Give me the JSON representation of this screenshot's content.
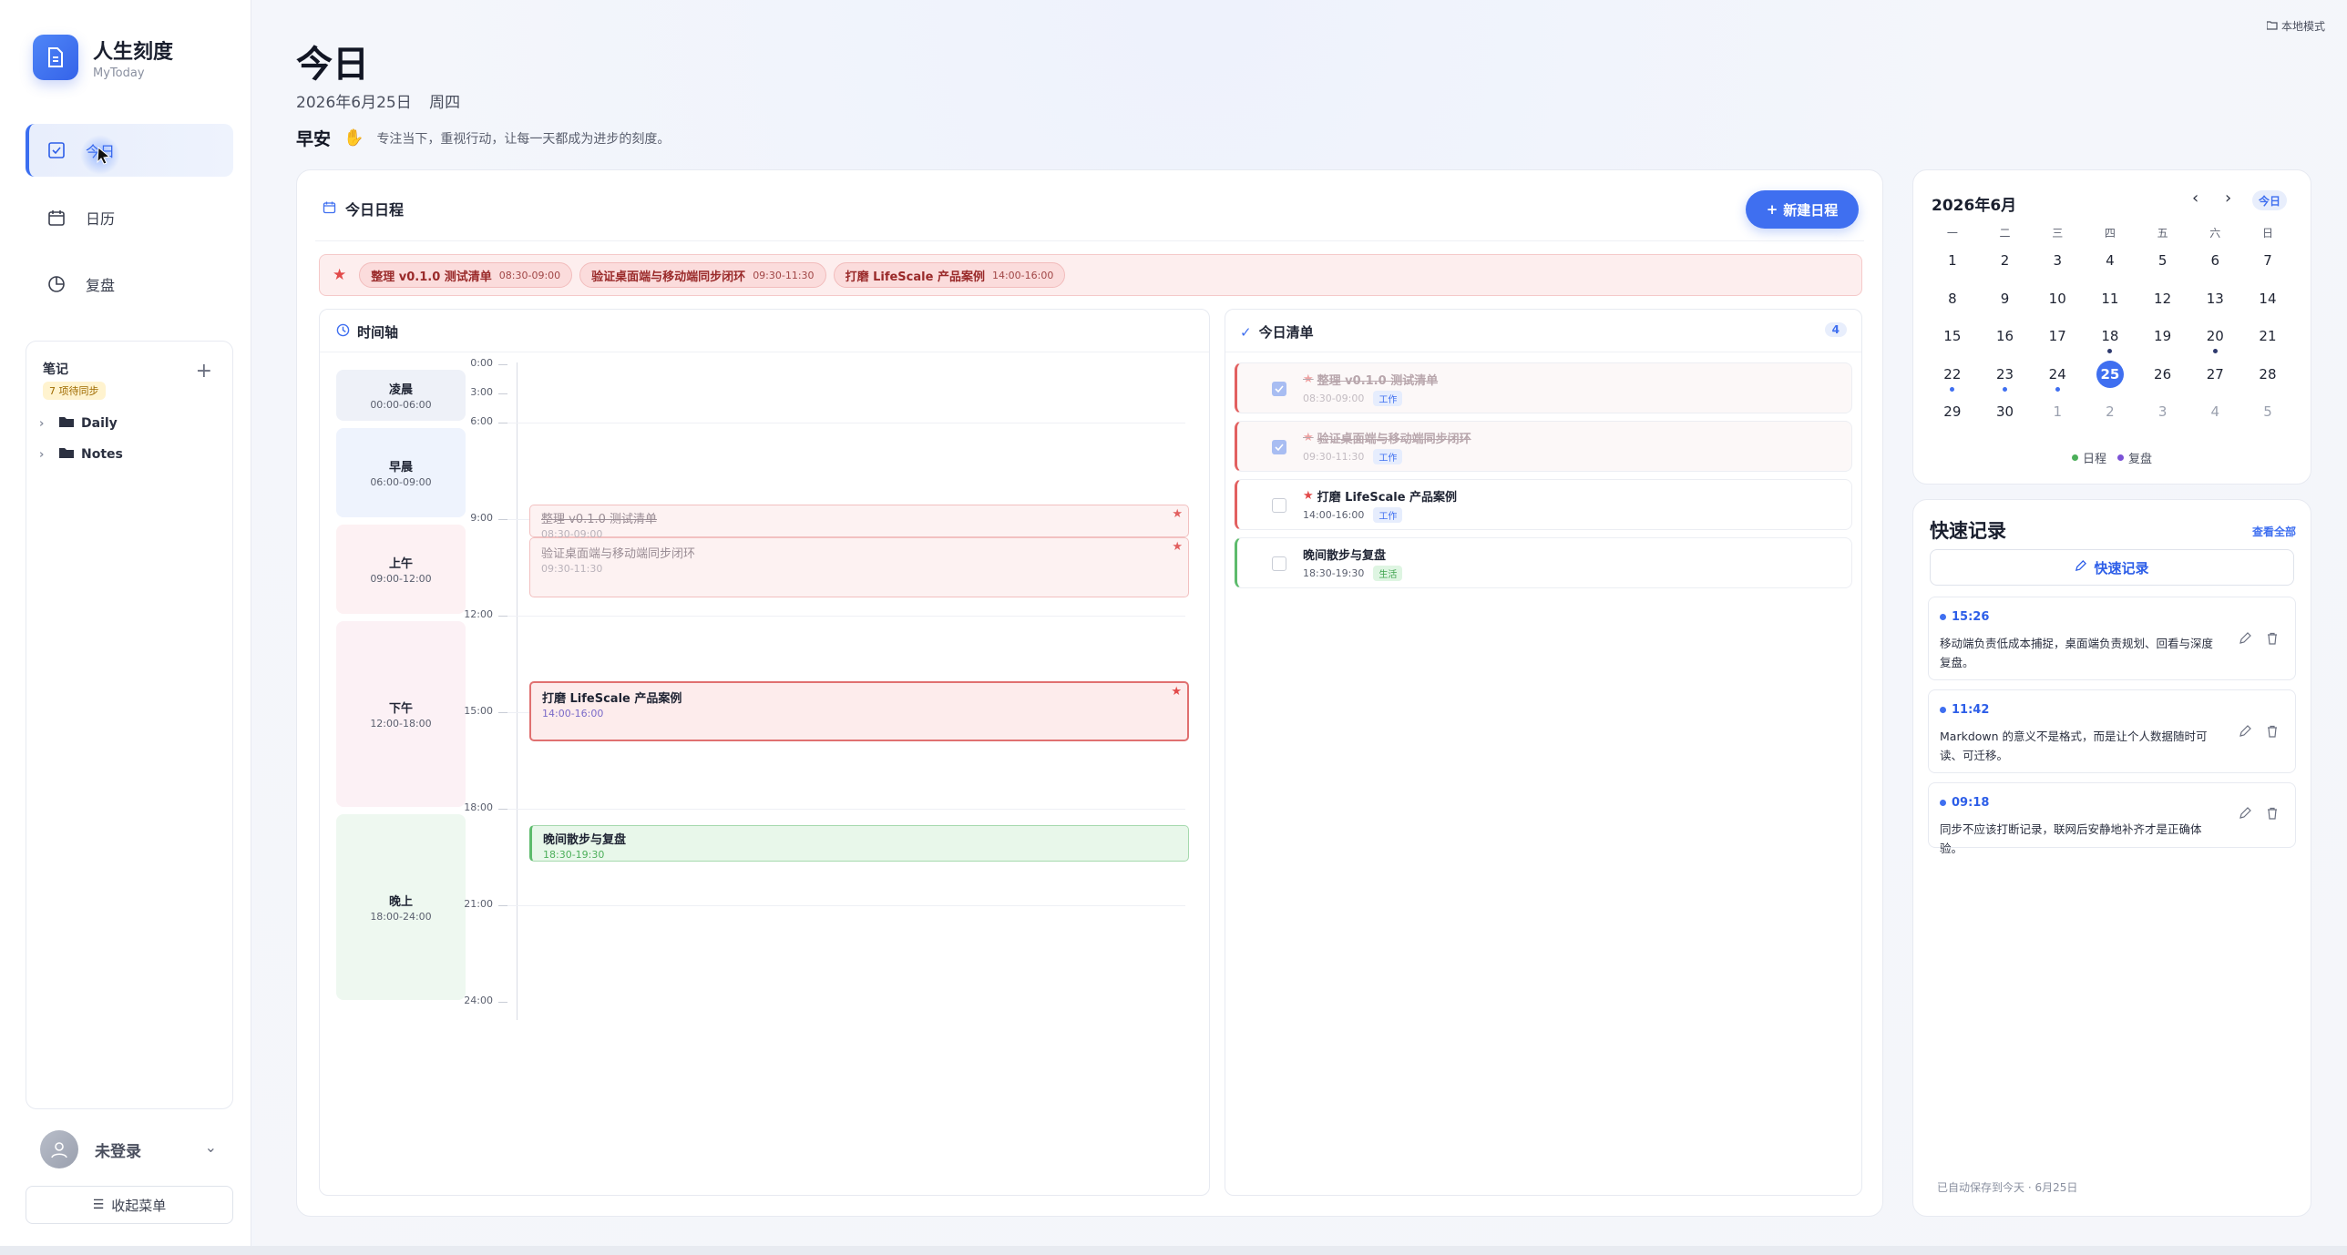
{
  "app": {
    "name": "人生刻度",
    "subtitle": "MyToday"
  },
  "nav": [
    {
      "label": "今日",
      "icon": "checkbox-icon",
      "active": true
    },
    {
      "label": "日历",
      "icon": "calendar-icon",
      "active": false
    },
    {
      "label": "复盘",
      "icon": "pie-chart-icon",
      "active": false
    }
  ],
  "notes": {
    "heading": "笔记",
    "badge": "7 项待同步",
    "folders": [
      "Daily",
      "Notes"
    ]
  },
  "user": {
    "name": "未登录"
  },
  "collapse_label": "收起菜单",
  "mode_label": "本地模式",
  "header": {
    "title": "今日",
    "date": "2026年6月25日",
    "weekday": "周四",
    "greeting": "早安",
    "motto": "专注当下，重视行动，让每一天都成为进步的刻度。"
  },
  "schedule": {
    "title": "今日日程",
    "new_button": "新建日程",
    "focus": [
      {
        "title": "整理 v0.1.0 测试清单",
        "time": "08:30-09:00"
      },
      {
        "title": "验证桌面端与移动端同步闭环",
        "time": "09:30-11:30"
      },
      {
        "title": "打磨 LifeScale 产品案例",
        "time": "14:00-16:00"
      }
    ],
    "timeline": {
      "title": "时间轴",
      "periods": [
        {
          "name": "凌晨",
          "range": "00:00-06:00"
        },
        {
          "name": "早晨",
          "range": "06:00-09:00"
        },
        {
          "name": "上午",
          "range": "09:00-12:00"
        },
        {
          "name": "下午",
          "range": "12:00-18:00"
        },
        {
          "name": "晚上",
          "range": "18:00-24:00"
        }
      ],
      "hours": [
        "0:00",
        "3:00",
        "6:00",
        "9:00",
        "12:00",
        "15:00",
        "18:00",
        "21:00",
        "24:00"
      ],
      "events": [
        {
          "title": "整理 v0.1.0 测试清单",
          "time": "08:30-09:00"
        },
        {
          "title": "验证桌面端与移动端同步闭环",
          "time": "09:30-11:30"
        },
        {
          "title": "打磨 LifeScale 产品案例",
          "time": "14:00-16:00"
        },
        {
          "title": "晚间散步与复盘",
          "time": "18:30-19:30"
        }
      ]
    },
    "checklist": {
      "title": "今日清单",
      "count": "4",
      "items": [
        {
          "title": "整理 v0.1.0 测试清单",
          "time": "08:30-09:00",
          "tag": "工作",
          "done": true,
          "starred": true
        },
        {
          "title": "验证桌面端与移动端同步闭环",
          "time": "09:30-11:30",
          "tag": "工作",
          "done": true,
          "starred": true
        },
        {
          "title": "打磨 LifeScale 产品案例",
          "time": "14:00-16:00",
          "tag": "工作",
          "done": false,
          "starred": true
        },
        {
          "title": "晚间散步与复盘",
          "time": "18:30-19:30",
          "tag": "生活",
          "done": false,
          "starred": false
        }
      ]
    }
  },
  "calendar": {
    "month": "2026年6月",
    "today_button": "今日",
    "weekdays": [
      "一",
      "二",
      "三",
      "四",
      "五",
      "六",
      "日"
    ],
    "selected_day": "25",
    "legend": [
      {
        "label": "日程",
        "color": "#4caf5a"
      },
      {
        "label": "复盘",
        "color": "#7b52d6"
      }
    ]
  },
  "quick_notes": {
    "title": "快速记录",
    "view_all": "查看全部",
    "button": "快速记录",
    "items": [
      {
        "time": "15:26",
        "text": "移动端负责低成本捕捉，桌面端负责规划、回看与深度复盘。"
      },
      {
        "time": "11:42",
        "text": "Markdown 的意义不是格式，而是让个人数据随时可读、可迁移。"
      },
      {
        "time": "09:18",
        "text": "同步不应该打断记录，联网后安静地补齐才是正确体验。"
      }
    ],
    "saved_status": "已自动保存到今天 · 6月25日"
  }
}
